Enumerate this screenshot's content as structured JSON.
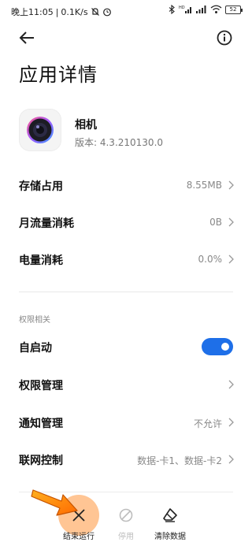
{
  "status_bar": {
    "time": "晚上11:05",
    "network_speed": "0.1K/s",
    "battery": "52",
    "icons": [
      "mute-icon",
      "alarm-icon",
      "bluetooth-icon",
      "hd-signal-icon",
      "signal-icon",
      "wifi-icon",
      "battery-icon"
    ]
  },
  "header": {
    "back_icon": "back-arrow-icon",
    "info_icon": "info-icon",
    "title": "应用详情"
  },
  "app": {
    "name": "相机",
    "version": "版本: 4.3.210130.0",
    "icon": "camera-app-icon"
  },
  "stats": [
    {
      "label": "存储占用",
      "value": "8.55MB"
    },
    {
      "label": "月流量消耗",
      "value": "0B"
    },
    {
      "label": "电量消耗",
      "value": "0.0%"
    }
  ],
  "permissions": {
    "section_title": "权限相关",
    "autostart": {
      "label": "自启动",
      "enabled": true
    },
    "items": [
      {
        "label": "权限管理",
        "value": ""
      },
      {
        "label": "通知管理",
        "value": "不允许"
      },
      {
        "label": "联网控制",
        "value": "数据-卡1、数据-卡2"
      }
    ]
  },
  "bottom_actions": [
    {
      "label": "结束运行",
      "icon": "close-x-icon",
      "enabled": true
    },
    {
      "label": "停用",
      "icon": "disable-icon",
      "enabled": false
    },
    {
      "label": "清除数据",
      "icon": "eraser-icon",
      "enabled": true
    }
  ],
  "colors": {
    "accent": "#1e6fe8",
    "highlight": "#ff963c"
  }
}
